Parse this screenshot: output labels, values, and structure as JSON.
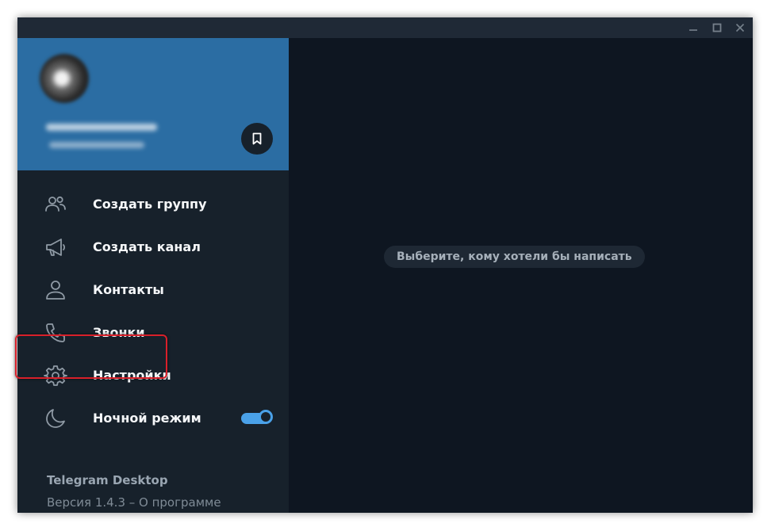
{
  "window": {
    "controls": {
      "minimize_icon": "minimize-icon",
      "maximize_icon": "maximize-icon",
      "close_icon": "close-icon"
    }
  },
  "sidebar": {
    "profile": {
      "name": "••••••••••••••••",
      "phone": "+• ••• ••• •• ••",
      "saved_messages_icon": "bookmark-icon"
    },
    "menu": [
      {
        "label": "Создать группу",
        "icon": "group-icon"
      },
      {
        "label": "Создать канал",
        "icon": "megaphone-icon"
      },
      {
        "label": "Контакты",
        "icon": "person-icon"
      },
      {
        "label": "Звонки",
        "icon": "phone-icon"
      },
      {
        "label": "Настройки",
        "icon": "gear-icon"
      },
      {
        "label": "Ночной режим",
        "icon": "moon-icon",
        "toggle_on": true
      }
    ],
    "footer": {
      "app_name": "Telegram Desktop",
      "version_prefix": "Версия 1.4.3 – ",
      "about_link": "О программе"
    }
  },
  "main": {
    "empty_hint": "Выберите, кому хотели бы написать"
  },
  "colors": {
    "profile_bg": "#2b6da3",
    "sidebar_bg": "#17212b",
    "main_bg": "#0e1621",
    "accent": "#4aa1e8",
    "highlight": "#d8202a"
  }
}
